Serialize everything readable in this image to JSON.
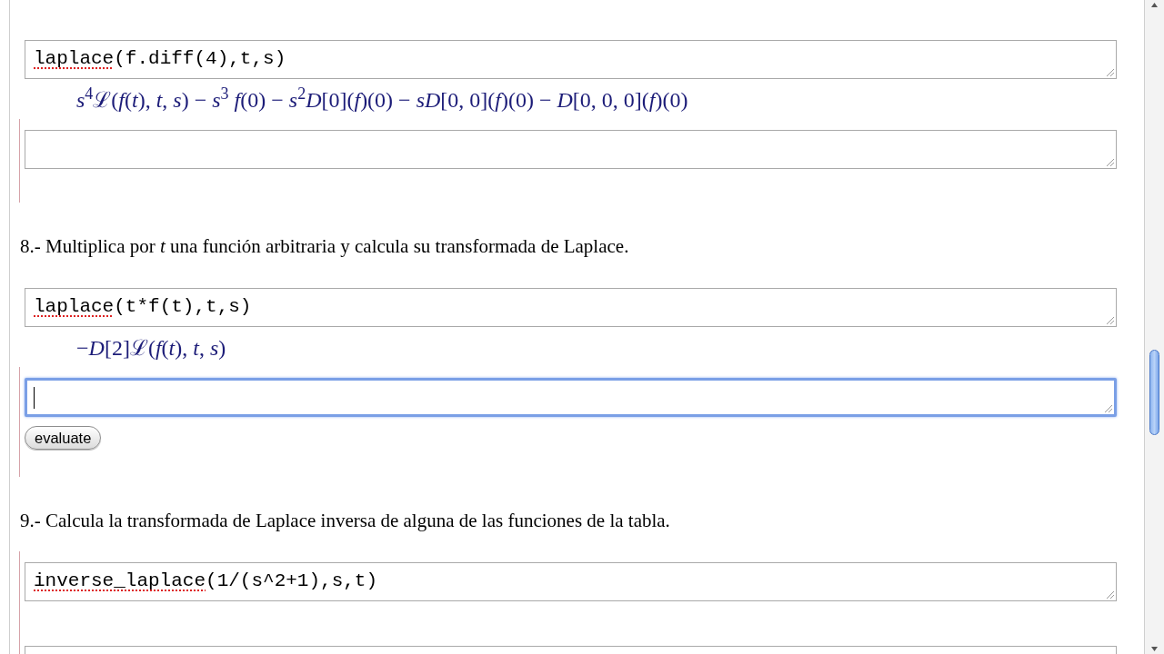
{
  "cells": [
    {
      "kind": "code",
      "highlighted": false,
      "focused": false,
      "code": [
        {
          "text": "laplace",
          "misspelled": true
        },
        {
          "text": "(f.diff(4),t,s)",
          "misspelled": false
        }
      ],
      "output": "*s*$^{4}$ℒ(*f*(*t*), *t*, *s*) − *s*$^{3}$ *f*(0) − *s*$^{2}$*D*[0](*f*)(0) − *sD*[0, 0](*f*)(0) − *D*[0, 0, 0](*f*)(0)"
    },
    {
      "kind": "code",
      "highlighted": true,
      "focused": false
    },
    {
      "kind": "text",
      "text": "8.- Multiplica por *t* una función arbitraria y calcula su transformada de Laplace."
    },
    {
      "kind": "code",
      "highlighted": false,
      "focused": false,
      "code": [
        {
          "text": "laplace",
          "misspelled": true
        },
        {
          "text": "(t*f(t),t,s)",
          "misspelled": false
        }
      ],
      "output": "−*D*[2]ℒ(*f*(*t*), *t*, *s*)"
    },
    {
      "kind": "code",
      "highlighted": true,
      "focused": true,
      "button": "evaluate"
    },
    {
      "kind": "text",
      "text": "9.- Calcula la transformada de Laplace inversa de alguna de las funciones de la tabla."
    },
    {
      "kind": "code",
      "highlighted": true,
      "focused": false,
      "code": [
        {
          "text": "inverse_laplace",
          "misspelled": true
        },
        {
          "text": "(1/(s^2+1),s,t)",
          "misspelled": false
        }
      ]
    },
    {
      "kind": "code",
      "highlighted": true,
      "focused": false
    }
  ]
}
